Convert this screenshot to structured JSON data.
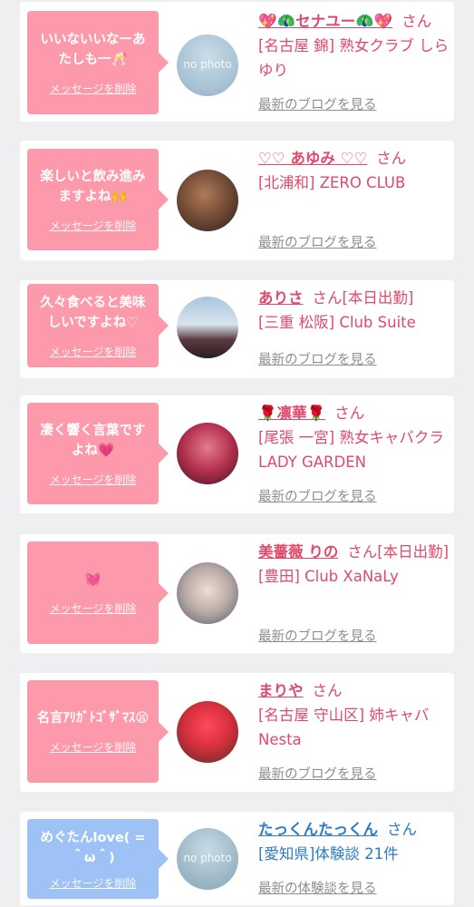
{
  "common": {
    "delete_label": "メッセージを削除",
    "san": "さん",
    "blog_link": "最新のブログを見る",
    "review_link": "最新の体験談を見る",
    "no_photo": "no photo"
  },
  "items": [
    {
      "message": "いいないいなーあたしも一🥂",
      "name": "💖🦚セナユー🦚💖",
      "detail": "[名古屋 錦] 熟女クラブ しらゆり",
      "avatar": "no-photo"
    },
    {
      "message": "楽しいと飲み進みますよね🙌",
      "name": "♡♡ あゆみ ♡♡",
      "detail": "[北浦和] ZERO CLUB",
      "avatar": "photo"
    },
    {
      "message": "久々食べると美味しいですよね♡",
      "name": "ありさ",
      "after_name": "さん[本日出勤]",
      "detail": "[三重 松阪] Club Suite",
      "avatar": "photo"
    },
    {
      "message": "凄く響く言葉ですよね💗",
      "name": "🌹凛華🌹",
      "detail": "[尾張 一宮] 熟女キャバクラ LADY GARDEN",
      "avatar": "photo"
    },
    {
      "message": "💓",
      "name": "美薔薇 りの",
      "after_name": "さん[本日出勤]",
      "detail": "[豊田] Club XaNaLy",
      "avatar": "photo"
    },
    {
      "message": "名言ｱﾘｶﾞﾄｺﾞｻﾞﾏｽ😫",
      "name": "まりや",
      "detail": "[名古屋 守山区] 姉キャバ Nesta",
      "avatar": "photo"
    },
    {
      "message": "めぐたんlove( =＾ω＾)",
      "name": "たっくんたっくん",
      "detail": "[愛知県]体験談 21件",
      "avatar": "no-photo"
    }
  ]
}
